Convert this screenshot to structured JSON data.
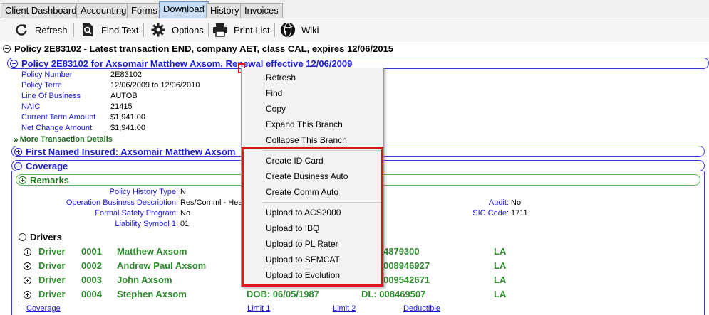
{
  "tabs": [
    {
      "label": "Client Dashboard",
      "active": false
    },
    {
      "label": "Accounting",
      "active": false
    },
    {
      "label": "Forms",
      "active": false
    },
    {
      "label": "Download",
      "active": true
    },
    {
      "label": "History",
      "active": false
    },
    {
      "label": "Invoices",
      "active": false
    }
  ],
  "toolbar": {
    "refresh": "Refresh",
    "find_text": "Find Text",
    "options": "Options",
    "print_list": "Print List",
    "wiki": "Wiki"
  },
  "tree": {
    "root_label": "Policy 2E83102 - Latest transaction END, company AET, class CAL, expires 12/06/2015",
    "policy_header": "Policy 2E83102 for Axsomair Matthew Axsom, Renewal effective 12/06/2009",
    "fields": [
      {
        "label": "Policy Number",
        "value": "2E83102"
      },
      {
        "label": "Policy Term",
        "value": "12/06/2009 to 12/06/2010"
      },
      {
        "label": "Line Of Business",
        "value": "AUTOB"
      },
      {
        "label": "NAIC",
        "value": "21415"
      },
      {
        "label": "Current Term Amount",
        "value": "$1,941.00"
      },
      {
        "label": "Net Change Amount",
        "value": "$1,941.00"
      }
    ],
    "more_details": "More Transaction Details",
    "first_named_insured": "First Named Insured: Axsomair Matthew Axsom",
    "coverage": "Coverage",
    "remarks": "Remarks",
    "remark_fields_left": [
      {
        "label": "Policy History Type:",
        "value": "N"
      },
      {
        "label": "Operation Business Description:",
        "value": "Res/Comml - Hea"
      },
      {
        "label": "Formal Safety Program:",
        "value": "No"
      },
      {
        "label": "Liability Symbol 1:",
        "value": "01"
      }
    ],
    "remark_fields_right": [
      {
        "label": "Audit:",
        "value": "No"
      },
      {
        "label": "SIC Code:",
        "value": "1711"
      }
    ],
    "drivers_label": "Drivers",
    "drivers": [
      {
        "type": "Driver",
        "num": "0001",
        "name": "Matthew Axsom",
        "dob": "",
        "dl": "4879300",
        "state": "LA"
      },
      {
        "type": "Driver",
        "num": "0002",
        "name": "Andrew Paul Axsom",
        "dob": "",
        "dl": "008946927",
        "state": "LA"
      },
      {
        "type": "Driver",
        "num": "0003",
        "name": "John Axsom",
        "dob": "",
        "dl": "009542671",
        "state": "LA"
      },
      {
        "type": "Driver",
        "num": "0004",
        "name": "Stephen Axsom",
        "dob": "DOB: 06/05/1987",
        "dl": "DL: 008469507",
        "state": "LA"
      }
    ],
    "footer_links": [
      "Coverage",
      "Limit 1",
      "Limit 2",
      "Deductible"
    ]
  },
  "context_menu": {
    "group1": [
      "Refresh",
      "Find",
      "Copy",
      "Expand This Branch",
      "Collapse This Branch"
    ],
    "group2": [
      "Create ID Card",
      "Create Business Auto",
      "Create Comm Auto"
    ],
    "group3": [
      "Upload to ACS2000",
      "Upload to IBQ",
      "Upload to PL Rater",
      "Upload to SEMCAT",
      "Upload to Evolution"
    ]
  },
  "colors": {
    "accent_blue": "#1a1ad8",
    "green": "#2d8a2d",
    "highlight_red": "#e0141e"
  }
}
